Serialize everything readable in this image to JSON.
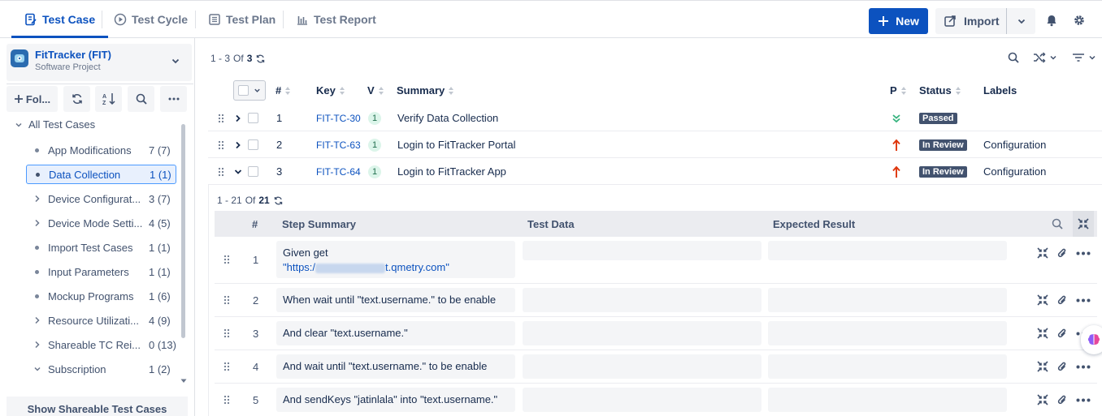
{
  "tabs": [
    {
      "label": "Test Case",
      "active": true
    },
    {
      "label": "Test Cycle",
      "active": false
    },
    {
      "label": "Test Plan",
      "active": false
    },
    {
      "label": "Test Report",
      "active": false
    }
  ],
  "toolbar": {
    "new_label": "New",
    "import_label": "Import"
  },
  "project": {
    "name": "FitTracker (FIT)",
    "type": "Software Project"
  },
  "sidebar": {
    "folder_button_label": "Fol...",
    "root_label": "All Test Cases",
    "items": [
      {
        "label": "App Modifications",
        "count": "7 (7)",
        "kind": "leaf"
      },
      {
        "label": "Data Collection",
        "count": "1 (1)",
        "kind": "leaf",
        "selected": true
      },
      {
        "label": "Device Configurat...",
        "count": "3 (7)",
        "kind": "folder"
      },
      {
        "label": "Device Mode Setti...",
        "count": "4 (5)",
        "kind": "folder"
      },
      {
        "label": "Import Test Cases",
        "count": "1 (1)",
        "kind": "leaf"
      },
      {
        "label": "Input Parameters",
        "count": "1 (1)",
        "kind": "leaf"
      },
      {
        "label": "Mockup Programs",
        "count": "1 (6)",
        "kind": "folder"
      },
      {
        "label": "Resource Utilizati...",
        "count": "4 (9)",
        "kind": "folder"
      },
      {
        "label": "Shareable TC Rei...",
        "count": "0 (13)",
        "kind": "folder"
      },
      {
        "label": "Subscription",
        "count": "1 (2)",
        "kind": "folder-open"
      }
    ],
    "show_shareable_label": "Show Shareable Test Cases"
  },
  "list": {
    "range": "1 - 3",
    "of_label": "Of",
    "total": "3",
    "columns": {
      "num": "#",
      "key": "Key",
      "version": "V",
      "summary": "Summary",
      "priority": "P",
      "status": "Status",
      "labels": "Labels"
    },
    "rows": [
      {
        "num": "1",
        "key": "FIT-TC-30",
        "version": "1",
        "summary": "Verify Data Collection",
        "priority": "low",
        "status": "Passed",
        "status_color": "#42526e",
        "labels": "",
        "expanded": false
      },
      {
        "num": "2",
        "key": "FIT-TC-63",
        "version": "1",
        "summary": "Login to FitTracker Portal",
        "priority": "high",
        "status": "In Review",
        "status_color": "#42526e",
        "labels": "Configuration",
        "expanded": false
      },
      {
        "num": "3",
        "key": "FIT-TC-64",
        "version": "1",
        "summary": "Login to FitTracker App",
        "priority": "high",
        "status": "In Review",
        "status_color": "#42526e",
        "labels": "Configuration",
        "expanded": true
      }
    ]
  },
  "steps": {
    "range": "1 - 21",
    "of_label": "Of",
    "total": "21",
    "columns": {
      "num": "#",
      "summary": "Step Summary",
      "data": "Test Data",
      "expected": "Expected Result"
    },
    "rows": [
      {
        "num": "1",
        "line1": "Given get",
        "url_prefix": "\"https:/",
        "url_suffix": "t.qmetry.com\""
      },
      {
        "num": "2",
        "text": "When wait until \"text.username.\" to be enable"
      },
      {
        "num": "3",
        "text": "And clear \"text.username.\""
      },
      {
        "num": "4",
        "text": "And wait until \"text.username.\" to be enable"
      },
      {
        "num": "5",
        "text": "And sendKeys \"jatinlala\" into \"text.username.\""
      }
    ]
  },
  "colors": {
    "primary": "#0c52bf",
    "passed_green": "#36b37e",
    "priority_red": "#de350b"
  }
}
